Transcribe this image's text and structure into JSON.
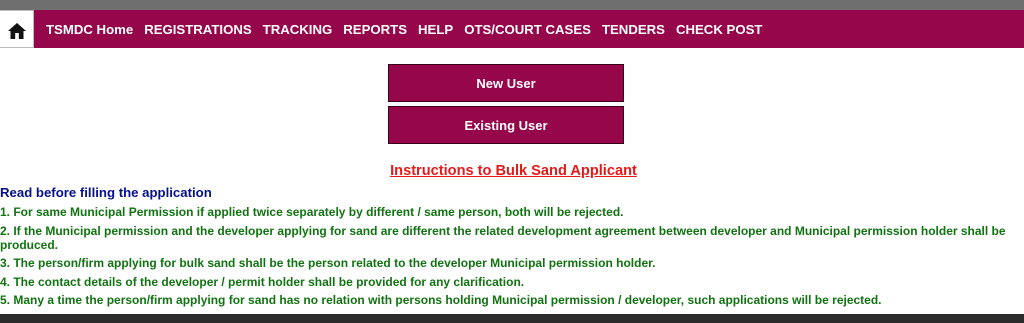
{
  "nav": {
    "home_icon": "home-icon",
    "items": [
      "TSMDC Home",
      "REGISTRATIONS",
      "TRACKING",
      "REPORTS",
      "HELP",
      "OTS/COURT CASES",
      "TENDERS",
      "CHECK POST"
    ]
  },
  "buttons": {
    "new_user": "New User",
    "existing_user": "Existing User"
  },
  "instructions_link": "Instructions to Bulk Sand Applicant",
  "read_before": "Read before filling the application",
  "instructions": [
    "1. For same Municipal Permission if applied twice separately by different / same person, both will be rejected.",
    "2. If the Municipal permission and the developer applying for sand are different the related development agreement between developer and Municipal permission holder shall be produced.",
    "3. The person/firm applying for bulk sand shall be the person related to the developer Municipal permission holder.",
    "4. The contact details of the developer / permit holder shall be provided for any clarification.",
    "5. Many a time the person/firm applying for sand has no relation with persons holding Municipal permission / developer, such applications will be rejected."
  ],
  "colors": {
    "brand": "#96064b",
    "link_red": "#e41a1a",
    "heading_blue": "#05108a",
    "instruction_green": "#117311"
  }
}
